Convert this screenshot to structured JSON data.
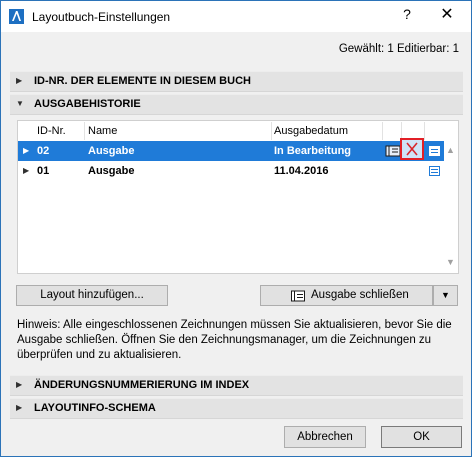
{
  "window": {
    "title": "Layoutbuch-Einstellungen",
    "help_label": "?",
    "close_label": "✕"
  },
  "selection_info": "Gewählt: 1 Editierbar: 1",
  "sections": {
    "ids": "ID-NR. DER ELEMENTE IN DIESEM BUCH",
    "history": "AUSGABEHISTORIE",
    "revision": "ÄNDERUNGSNUMMERIERUNG IM INDEX",
    "layoutinfo": "LAYOUTINFO-SCHEMA"
  },
  "table": {
    "columns": [
      "ID-Nr.",
      "Name",
      "Ausgabedatum"
    ],
    "rows": [
      {
        "id": "02",
        "name": "Ausgabe",
        "date": "In Bearbeitung"
      },
      {
        "id": "01",
        "name": "Ausgabe",
        "date": "11.04.2016"
      }
    ]
  },
  "buttons": {
    "add_layout": "Layout hinzufügen...",
    "close_issue": "Ausgabe schließen",
    "cancel": "Abbrechen",
    "ok": "OK"
  },
  "hint": "Hinweis: Alle eingeschlossenen Zeichnungen müssen Sie aktualisieren, bevor Sie die Ausgabe schließen. Öffnen Sie den Zeichnungsmanager, um die Zeichnungen zu überprüfen und zu aktualisieren.",
  "colors": {
    "selection": "#1f7bd8",
    "highlight_box": "#e21f26",
    "window_border": "#2b73b8"
  },
  "icons": {
    "app": "archicad-icon",
    "close_issue": "close-issue-icon",
    "delete": "delete-x-icon",
    "details": "details-icon",
    "expand": "triangle-right-icon",
    "collapse": "triangle-down-icon",
    "dropdown": "chevron-down-icon"
  }
}
